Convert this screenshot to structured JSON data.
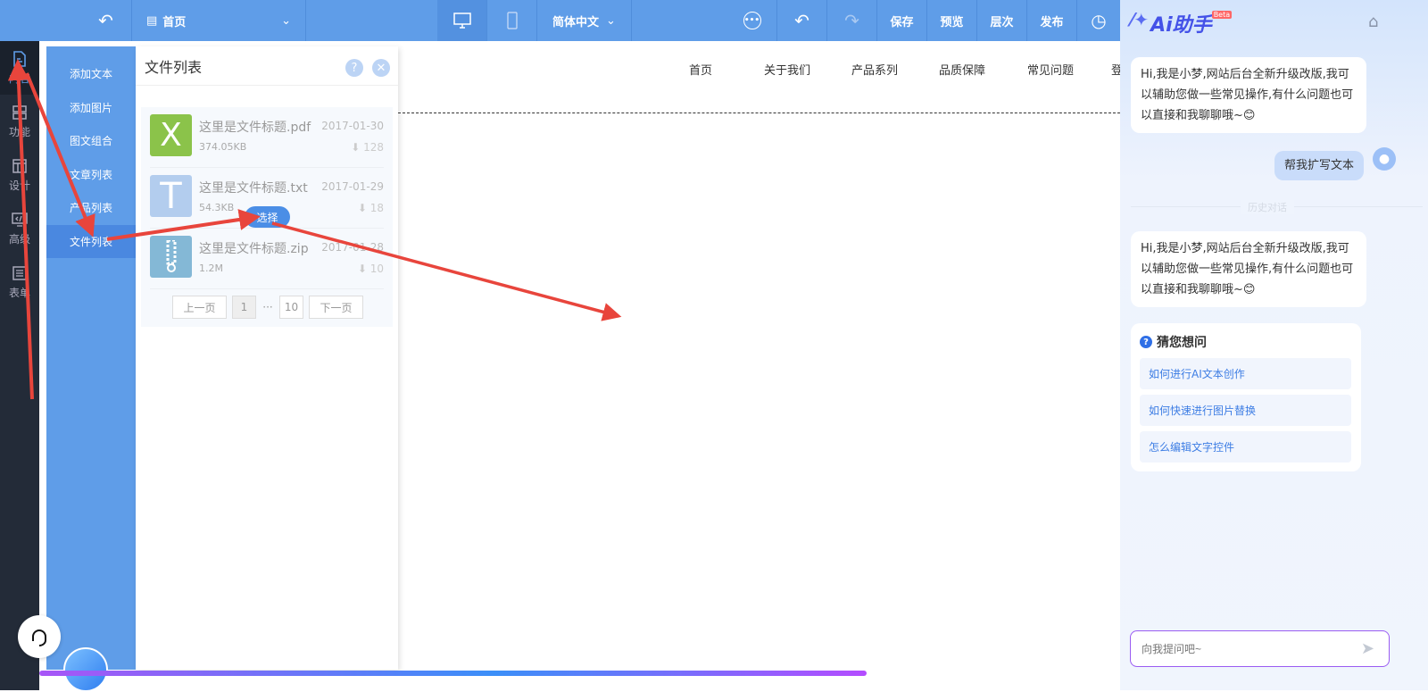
{
  "topbar": {
    "page_select": "首页",
    "language": "简体中文",
    "save": "保存",
    "preview": "预览",
    "layers": "层次",
    "publish": "发布"
  },
  "leftnav": [
    {
      "label": "内容",
      "icon": "document-icon"
    },
    {
      "label": "功能",
      "icon": "grid-icon"
    },
    {
      "label": "设计",
      "icon": "layout-icon"
    },
    {
      "label": "高级",
      "icon": "code-icon"
    },
    {
      "label": "表单",
      "icon": "list-icon"
    }
  ],
  "submenu": [
    "添加文本",
    "添加图片",
    "图文组合",
    "文章列表",
    "产品列表",
    "文件列表"
  ],
  "panel": {
    "title": "文件列表",
    "help": "?",
    "close": "✕",
    "files": [
      {
        "name": "这里是文件标题.pdf",
        "size": "374.05KB",
        "date": "2017-01-30",
        "downloads": "128",
        "type": "XLSX",
        "glyph": "X",
        "color": "#8bc34a"
      },
      {
        "name": "这里是文件标题.txt",
        "size": "54.3KB",
        "date": "2017-01-29",
        "downloads": "18",
        "type": "TXT",
        "glyph": "T",
        "color": "#b3cdee"
      },
      {
        "name": "这里是文件标题.zip",
        "size": "1.2M",
        "date": "2017-01-28",
        "downloads": "10",
        "type": "ZIP",
        "glyph": "",
        "color": "#84b8d6"
      }
    ],
    "select_button": "选择",
    "pager": {
      "prev": "上一页",
      "current": "1",
      "ellipsis": "···",
      "last": "10",
      "next": "下一页"
    }
  },
  "site_nav": [
    "首页",
    "关于我们",
    "产品系列",
    "品质保障",
    "常见问题",
    "登"
  ],
  "ai": {
    "title": "Ai助手",
    "badge": "Beta",
    "greeting": "Hi,我是小梦,网站后台全新升级改版,我可以辅助您做一些常见操作,有什么问题也可以直接和我聊聊哦~😊",
    "user_msg": "帮我扩写文本",
    "history_divider": "历史对话",
    "guess_title": "猜您想问",
    "guess": [
      "如何进行AI文本创作",
      "如何快速进行图片替换",
      "怎么编辑文字控件"
    ],
    "input_placeholder": "向我提问吧~"
  },
  "colors": {
    "accent": "#5f9de8",
    "annotation": "#e8453c"
  }
}
